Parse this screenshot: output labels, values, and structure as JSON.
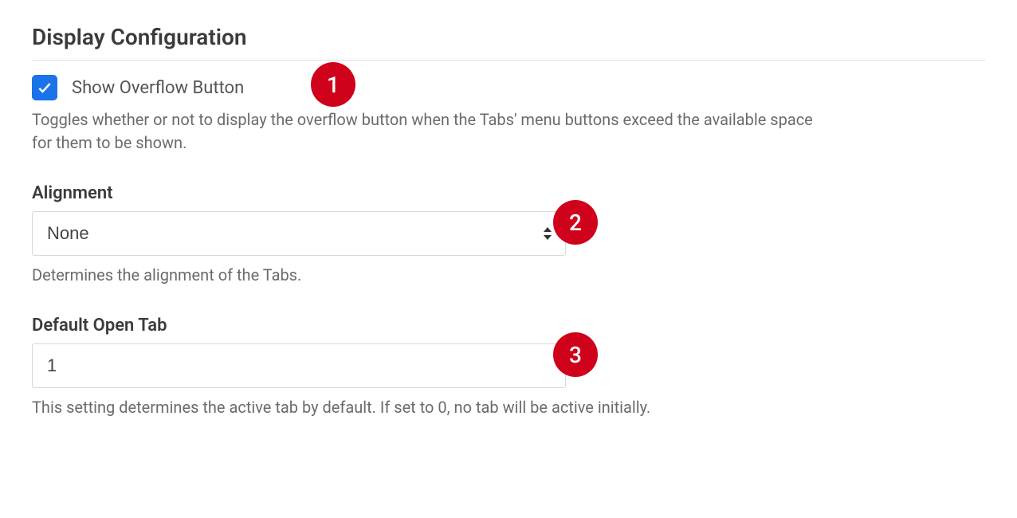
{
  "section": {
    "title": "Display Configuration"
  },
  "show_overflow": {
    "label": "Show Overflow Button",
    "checked": true,
    "help": "Toggles whether or not to display the overflow button when the Tabs' menu buttons exceed the available space for them to be shown."
  },
  "alignment": {
    "label": "Alignment",
    "value": "None",
    "help": "Determines the alignment of the Tabs."
  },
  "default_open_tab": {
    "label": "Default Open Tab",
    "value": "1",
    "help": "This setting determines the active tab by default. If set to 0, no tab will be active initially."
  },
  "annotations": {
    "one": "1",
    "two": "2",
    "three": "3"
  }
}
